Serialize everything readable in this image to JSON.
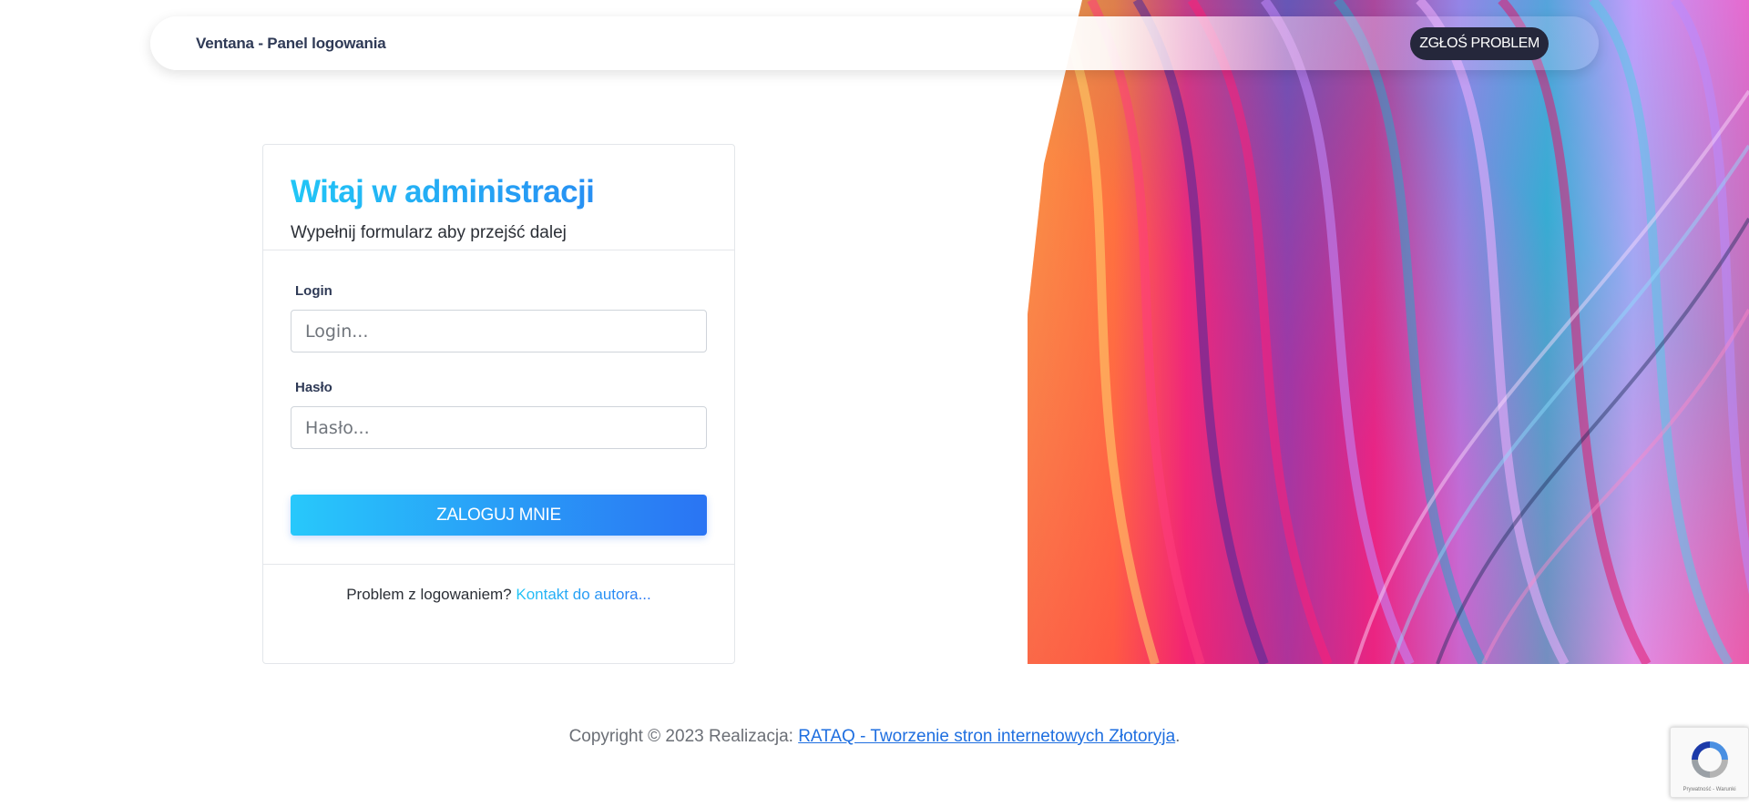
{
  "navbar": {
    "brand": "Ventana - Panel logowania",
    "report_button": "ZGŁOŚ PROBLEM"
  },
  "login_card": {
    "title": "Witaj w administracji",
    "subtitle": "Wypełnij formularz aby przejść dalej",
    "login_label": "Login",
    "login_placeholder": "Login...",
    "password_label": "Hasło",
    "password_placeholder": "Hasło...",
    "submit_button": "ZALOGUJ MNIE",
    "footer_text": "Problem z logowaniem?",
    "footer_link": "Kontakt do autora..."
  },
  "page_footer": {
    "copyright": "Copyright © 2023 Realizacja:",
    "link": "RATAQ - Tworzenie stron internetowych Złotoryja",
    "trailing": "."
  },
  "recaptcha": {
    "text": "Prywatność - Warunki"
  },
  "colors": {
    "accent_start": "#21c6f6",
    "accent_end": "#2a74f3",
    "dark": "#25273b",
    "label": "#2f3a56"
  }
}
